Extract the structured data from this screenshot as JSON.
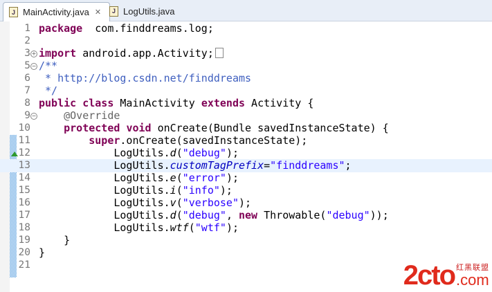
{
  "tabs": [
    {
      "label": "MainActivity.java",
      "icon": "java-file-icon",
      "active": true
    },
    {
      "label": "LogUtils.java",
      "icon": "java-file-icon",
      "active": false
    }
  ],
  "tab_icon_letter": "J",
  "close_glyph": "✕",
  "current_line": 13,
  "lines": [
    {
      "n": "1",
      "t": [
        [
          "kw",
          "package"
        ],
        [
          "",
          "  com.finddreams.log;"
        ]
      ]
    },
    {
      "n": "2",
      "t": []
    },
    {
      "n": "3",
      "fold": "+",
      "t": [
        [
          "kw",
          "import"
        ],
        [
          "",
          " android.app.Activity;"
        ]
      ],
      "box": true
    },
    {
      "n": "5",
      "fold": "-",
      "t": [
        [
          "cm",
          "/**"
        ]
      ]
    },
    {
      "n": "6",
      "t": [
        [
          "cm",
          " * http://blog.csdn.net/finddreams"
        ]
      ]
    },
    {
      "n": "7",
      "t": [
        [
          "cm",
          " */"
        ]
      ]
    },
    {
      "n": "8",
      "t": [
        [
          "kw",
          "public"
        ],
        [
          "",
          " "
        ],
        [
          "kw",
          "class"
        ],
        [
          "",
          " MainActivity "
        ],
        [
          "kw",
          "extends"
        ],
        [
          "",
          " Activity {"
        ]
      ]
    },
    {
      "n": "9",
      "fold": "-",
      "t": [
        [
          "",
          "    "
        ],
        [
          "ann",
          "@Override"
        ]
      ]
    },
    {
      "n": "10",
      "t": [
        [
          "",
          "    "
        ],
        [
          "kw",
          "protected"
        ],
        [
          "",
          " "
        ],
        [
          "kw",
          "void"
        ],
        [
          "",
          " onCreate(Bundle savedInstanceState) {"
        ]
      ]
    },
    {
      "n": "11",
      "t": [
        [
          "",
          "        "
        ],
        [
          "kw",
          "super"
        ],
        [
          "",
          ".onCreate(savedInstanceState);"
        ]
      ]
    },
    {
      "n": "12",
      "t": [
        [
          "",
          "            LogUtils."
        ],
        [
          "it",
          "d"
        ],
        [
          "",
          "("
        ],
        [
          "str",
          "\"debug\""
        ],
        [
          "",
          ");"
        ]
      ]
    },
    {
      "n": "13",
      "t": [
        [
          "",
          "            LogUtils."
        ],
        [
          "fld",
          "customTagPrefix"
        ],
        [
          "",
          "="
        ],
        [
          "str",
          "\"finddreams\""
        ],
        [
          "",
          ";"
        ]
      ]
    },
    {
      "n": "14",
      "t": [
        [
          "",
          "            LogUtils."
        ],
        [
          "it",
          "e"
        ],
        [
          "",
          "("
        ],
        [
          "str",
          "\"error\""
        ],
        [
          "",
          ");"
        ]
      ]
    },
    {
      "n": "15",
      "t": [
        [
          "",
          "            LogUtils."
        ],
        [
          "it",
          "i"
        ],
        [
          "",
          "("
        ],
        [
          "str",
          "\"info\""
        ],
        [
          "",
          ");"
        ]
      ]
    },
    {
      "n": "16",
      "t": [
        [
          "",
          "            LogUtils."
        ],
        [
          "it",
          "v"
        ],
        [
          "",
          "("
        ],
        [
          "str",
          "\"verbose\""
        ],
        [
          "",
          ");"
        ]
      ]
    },
    {
      "n": "17",
      "t": [
        [
          "",
          "            LogUtils."
        ],
        [
          "it",
          "d"
        ],
        [
          "",
          "("
        ],
        [
          "str",
          "\"debug\""
        ],
        [
          "",
          ", "
        ],
        [
          "kw",
          "new"
        ],
        [
          "",
          " Throwable("
        ],
        [
          "str",
          "\"debug\""
        ],
        [
          "",
          "));"
        ]
      ]
    },
    {
      "n": "18",
      "t": [
        [
          "",
          "            LogUtils."
        ],
        [
          "it",
          "wtf"
        ],
        [
          "",
          "("
        ],
        [
          "str",
          "\"wtf\""
        ],
        [
          "",
          ");"
        ]
      ]
    },
    {
      "n": "19",
      "t": [
        [
          "",
          "    }"
        ]
      ]
    },
    {
      "n": "20",
      "t": [
        [
          "",
          "}"
        ]
      ]
    },
    {
      "n": "21",
      "t": []
    }
  ],
  "watermark": {
    "main": "2cto",
    "cn": "红黑联盟",
    "com": ".com"
  }
}
